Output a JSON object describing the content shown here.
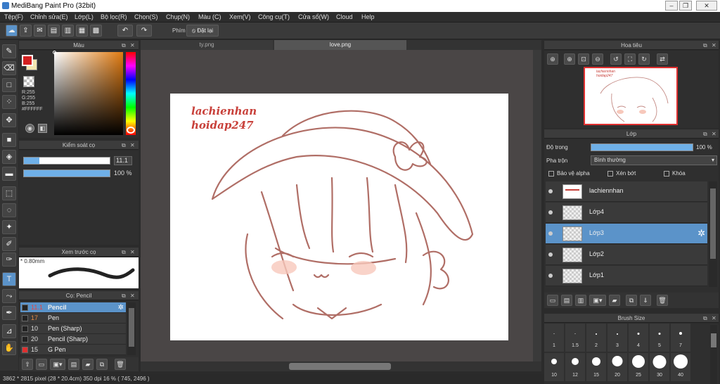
{
  "window": {
    "title": "MediBang Paint Pro (32bit)"
  },
  "menu": [
    "Tệp(F)",
    "Chỉnh sửa(E)",
    "Lớp(L)",
    "Bộ lọc(R)",
    "Chọn(S)",
    "Chụp(N)",
    "Màu (C)",
    "Xem(V)",
    "Công cụ(T)",
    "Cửa sổ(W)",
    "Cloud",
    "Help"
  ],
  "toolbar": {
    "phim_label": "Phím",
    "reset_label": "Đặt lại"
  },
  "color_panel": {
    "title": "Màu",
    "r": "R:255",
    "g": "G:255",
    "b": "B:255",
    "hex": "#FFFFFF",
    "primary_color": "#d42020",
    "secondary_color": "#f5e6b0"
  },
  "brush_control": {
    "title": "Kiểm soát cọ",
    "size_value": "11.1",
    "opacity_value": "100 %",
    "size_level": 0.18,
    "opacity_level": 1.0
  },
  "brush_preview": {
    "title": "Xem trước cọ",
    "size_label": "0.80mm"
  },
  "brush_list": {
    "title": "Cọ: Pencil",
    "items": [
      {
        "size": "11.1",
        "name": "Pencil",
        "selected": true,
        "swatch": "#222222"
      },
      {
        "size": "17",
        "name": "Pen",
        "selected": false,
        "swatch": "#222222"
      },
      {
        "size": "10",
        "name": "Pen (Sharp)",
        "selected": false,
        "swatch": "#222222"
      },
      {
        "size": "20",
        "name": "Pencil (Sharp)",
        "selected": false,
        "swatch": "#222222"
      },
      {
        "size": "15",
        "name": "G Pen",
        "selected": false,
        "swatch": "#e03030"
      }
    ]
  },
  "tabs": [
    "ty.png",
    "love.png"
  ],
  "canvas": {
    "watermark_line1": "lachienhan",
    "watermark_line2": "hoidap247"
  },
  "navigator": {
    "title": "Hoa tiêu",
    "wm1": "lachiennhan",
    "wm2": "hoidap247"
  },
  "layer_panel": {
    "title": "Lớp",
    "opacity_label": "Độ trong",
    "opacity_value": "100 %",
    "opacity_level": 1.0,
    "blend_label": "Pha trộn",
    "blend_value": "Bình thường",
    "protect_alpha": "Bảo vệ alpha",
    "clipping": "Xén bớt",
    "lock": "Khóa",
    "layers": [
      {
        "name": "lachiennhan",
        "selected": false
      },
      {
        "name": "Lớp4",
        "selected": false
      },
      {
        "name": "Lớp3",
        "selected": true
      },
      {
        "name": "Lớp2",
        "selected": false
      },
      {
        "name": "Lớp1",
        "selected": false
      }
    ]
  },
  "brush_size": {
    "title": "Brush Size",
    "row1": [
      "1",
      "1.5",
      "2",
      "3",
      "4",
      "5",
      "7"
    ],
    "row2": [
      "10",
      "12",
      "15",
      "20",
      "25",
      "30",
      "40"
    ]
  },
  "status": {
    "text": "3862 * 2815 pixel   (28 * 20.4cm)   350 dpi   16 %   ( 745, 2496 )"
  }
}
